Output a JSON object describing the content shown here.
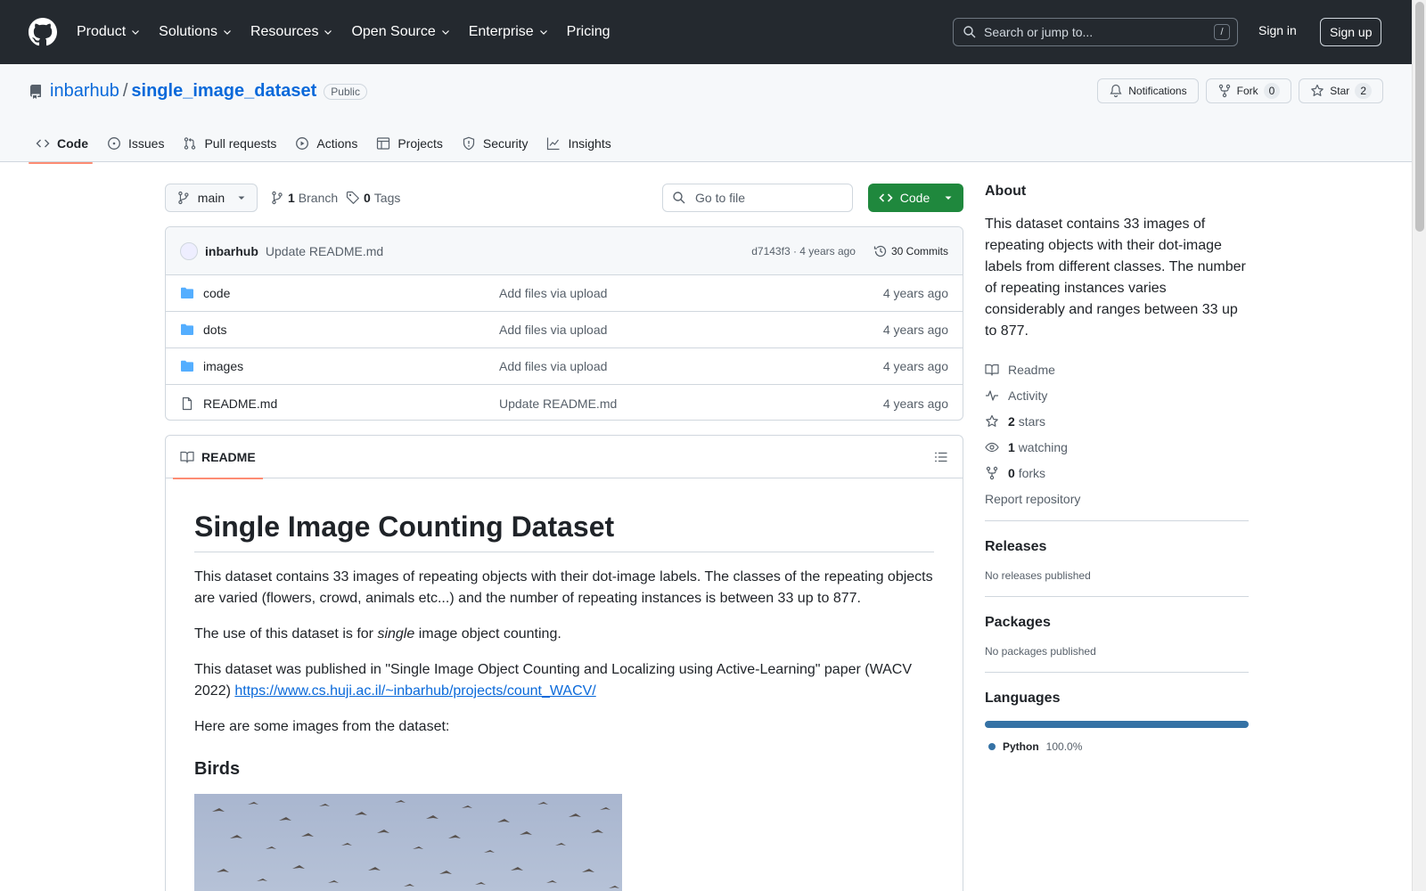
{
  "header": {
    "nav": [
      "Product",
      "Solutions",
      "Resources",
      "Open Source",
      "Enterprise",
      "Pricing"
    ],
    "search_placeholder": "Search or jump to...",
    "search_shortcut": "/",
    "sign_in": "Sign in",
    "sign_up": "Sign up"
  },
  "repo": {
    "owner": "inbarhub",
    "separator": "/",
    "name": "single_image_dataset",
    "visibility": "Public",
    "notifications": "Notifications",
    "fork_label": "Fork",
    "fork_count": "0",
    "star_label": "Star",
    "star_count": "2",
    "tabs": [
      "Code",
      "Issues",
      "Pull requests",
      "Actions",
      "Projects",
      "Security",
      "Insights"
    ]
  },
  "branchbar": {
    "branch": "main",
    "branch_count": "1",
    "branch_label": "Branch",
    "tag_count": "0",
    "tag_label": "Tags",
    "goto_placeholder": "Go to file",
    "code_button": "Code"
  },
  "commit": {
    "author": "inbarhub",
    "message": "Update README.md",
    "hash_time": "d7143f3 · 4 years ago",
    "commits": "30 Commits"
  },
  "files": [
    {
      "name": "code",
      "type": "folder",
      "message": "Add files via upload",
      "age": "4 years ago"
    },
    {
      "name": "dots",
      "type": "folder",
      "message": "Add files via upload",
      "age": "4 years ago"
    },
    {
      "name": "images",
      "type": "folder",
      "message": "Add files via upload",
      "age": "4 years ago"
    },
    {
      "name": "README.md",
      "type": "file",
      "message": "Update README.md",
      "age": "4 years ago"
    }
  ],
  "readme": {
    "tab": "README",
    "title": "Single Image Counting Dataset",
    "p1": "This dataset contains 33 images of repeating objects with their dot-image labels. The classes of the repeating objects are varied (flowers, crowd, animals etc...) and the number of repeating instances is between 33 up to 877.",
    "p2_before": "The use of this dataset is for ",
    "p2_em": "single",
    "p2_after": " image object counting.",
    "p3": "This dataset was published in \"Single Image Object Counting and Localizing using Active-Learning\" paper (WACV 2022) ",
    "p3_link": "https://www.cs.huji.ac.il/~inbarhub/projects/count_WACV/",
    "p4": "Here are some images from the dataset:",
    "h2_birds": "Birds"
  },
  "sidebar": {
    "about_title": "About",
    "about_text": "This dataset contains 33 images of repeating objects with their dot-image labels from different classes. The number of repeating instances varies considerably and ranges between 33 up to 877.",
    "readme": "Readme",
    "activity": "Activity",
    "stars_count": "2",
    "stars_label": "stars",
    "watching_count": "1",
    "watching_label": "watching",
    "forks_count": "0",
    "forks_label": "forks",
    "report": "Report repository",
    "releases_title": "Releases",
    "releases_text": "No releases published",
    "packages_title": "Packages",
    "packages_text": "No packages published",
    "languages_title": "Languages",
    "language_name": "Python",
    "language_pct": "100.0%",
    "language_color": "#3572a5"
  }
}
